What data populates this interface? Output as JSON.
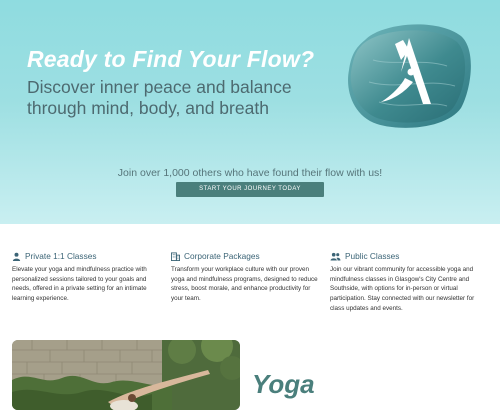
{
  "hero": {
    "title": "Ready to Find Your Flow?",
    "subtitle": "Discover inner peace and balance through mind, body, and breath",
    "join_text": "Join over 1,000 others who have found their flow with us!",
    "cta_label": "START YOUR JOURNEY TODAY",
    "logo_icon": "logo-a-mark",
    "background_color": "#9ddfe2",
    "cta_color": "#4a7f7c"
  },
  "features": [
    {
      "icon": "person-icon",
      "title": "Private 1:1 Classes",
      "description": "Elevate your yoga and mindfulness practice with personalized sessions tailored to your goals and needs, offered in a private setting for an intimate learning experience."
    },
    {
      "icon": "building-icon",
      "title": "Corporate Packages",
      "description": "Transform your workplace culture with our proven yoga and mindfulness programs, designed to reduce stress, boost morale, and enhance productivity for your team."
    },
    {
      "icon": "group-icon",
      "title": "Public Classes",
      "description": "Join our vibrant community for accessible yoga and mindfulness classes in Glasgow's City Centre and Southside, with options for in-person or virtual participation. Stay connected with our newsletter for class updates and events."
    }
  ],
  "section": {
    "heading": "Yoga",
    "photo_icon": "yoga-pose-photo"
  },
  "colors": {
    "accent": "#4a7f7c",
    "feature_title": "#3b6476",
    "subtitle": "#4d6a70"
  }
}
